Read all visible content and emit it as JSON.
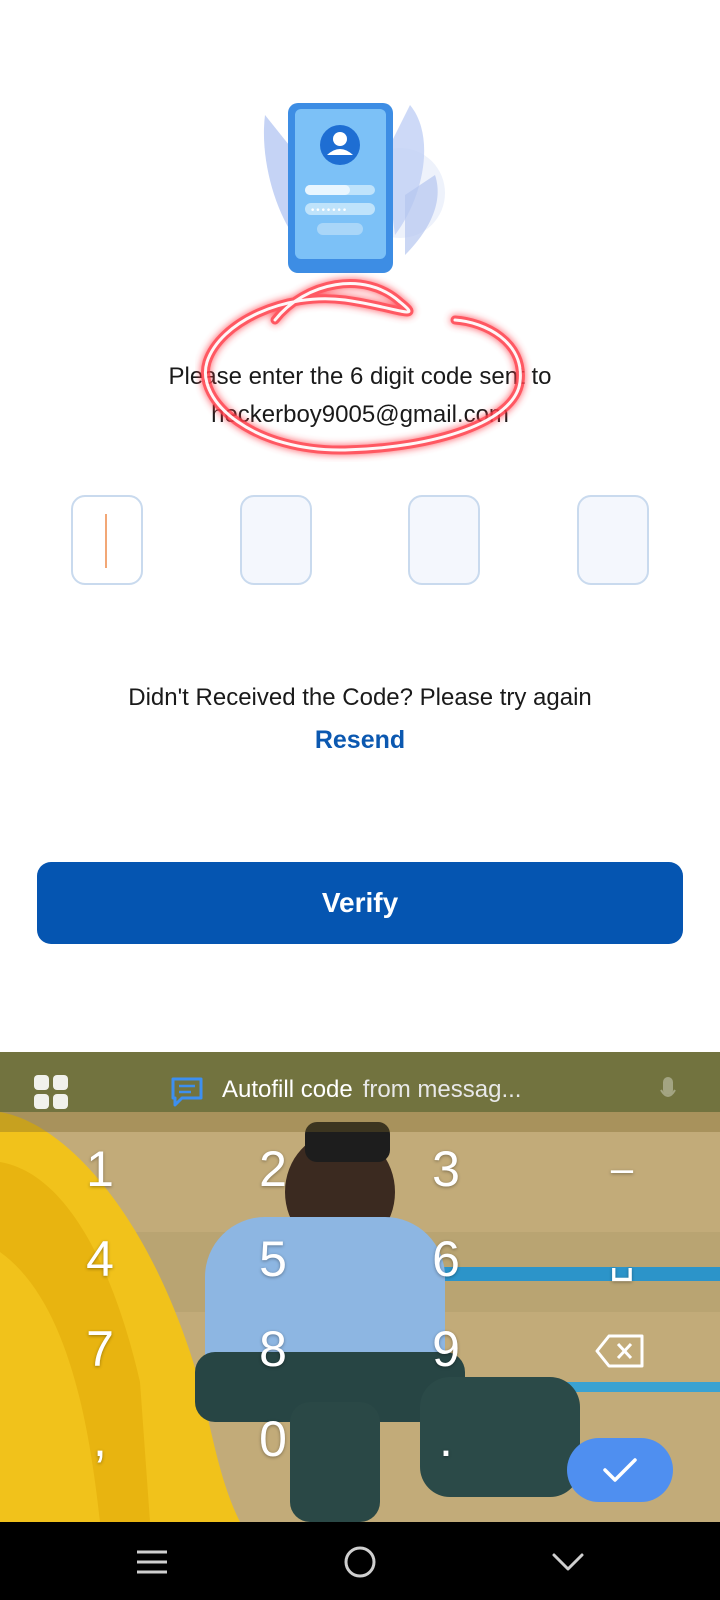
{
  "prompt": {
    "line1": "Please enter the 6 digit code sent to",
    "line2": "heckerboy9005@gmail.com"
  },
  "otp_boxes": [
    "",
    "",
    "",
    ""
  ],
  "retry": {
    "text": "Didn't Received the Code? Please try again",
    "resend_label": "Resend"
  },
  "verify_label": "Verify",
  "keyboard": {
    "suggestion_main": "Autofill code",
    "suggestion_sub": "from messag...",
    "keys": {
      "k1": "1",
      "k2": "2",
      "k3": "3",
      "dash": "–",
      "k4": "4",
      "k5": "5",
      "k6": "6",
      "space": "␣",
      "k7": "7",
      "k8": "8",
      "k9": "9",
      "comma": ",",
      "k0": "0",
      "period": "."
    }
  },
  "colors": {
    "primary": "#0555b1",
    "resend": "#0b58b0",
    "enter_key": "#4f8ff0",
    "annotation_red": "#e8192c"
  },
  "icons": [
    "phone-login-illustration",
    "apps-grid-icon",
    "message-icon",
    "mic-icon",
    "backspace-icon",
    "checkmark-icon",
    "menu-icon",
    "home-circle-icon",
    "back-chevron-icon"
  ]
}
